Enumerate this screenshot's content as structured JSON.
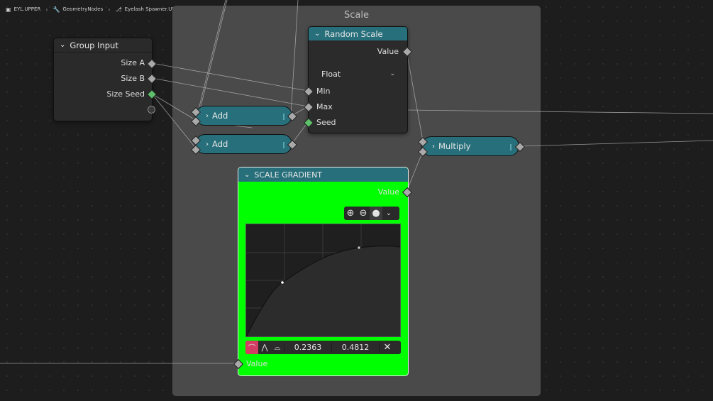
{
  "breadcrumb": {
    "object": "EYL.UPPER",
    "modifier": "GeometryNodes",
    "node_group": "Eyelash Spawner.UPPER"
  },
  "frame": {
    "title": "Scale"
  },
  "group_input": {
    "title": "Group Input",
    "outputs": [
      "Size A",
      "Size B",
      "Size Seed"
    ]
  },
  "random_scale": {
    "title": "Random Scale",
    "output": "Value",
    "data_type": "Float",
    "inputs": [
      "Min",
      "Max",
      "Seed"
    ]
  },
  "add_nodes": [
    {
      "label": "Add"
    },
    {
      "label": "Add"
    }
  ],
  "multiply_node": {
    "label": "Multiply"
  },
  "scale_gradient": {
    "title": "SCALE GRADIENT",
    "output": "Value",
    "input": "Value",
    "background_color": "#00ff00",
    "toolbar_icons": [
      "zoom-in-icon",
      "zoom-out-icon",
      "dot-icon",
      "chevron-down-icon"
    ],
    "handle_icons": [
      "auto-clamped-handle-icon",
      "vector-handle-icon",
      "free-handle-icon"
    ],
    "point_x": "0.2363",
    "point_y": "0.4812"
  },
  "colors": {
    "node_header": "#27707b",
    "socket_float": "#a9a9a9",
    "socket_int": "#5fbf6b",
    "curve_handle_active": "#d23e63"
  }
}
